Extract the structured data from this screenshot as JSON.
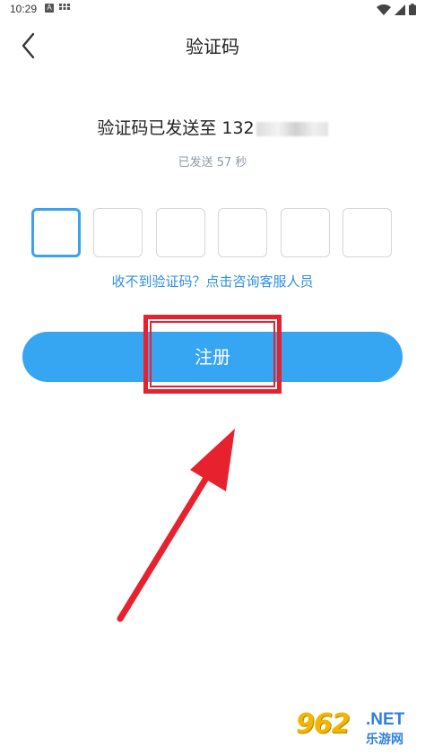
{
  "status_bar": {
    "time": "10:29",
    "notification_a": "A"
  },
  "header": {
    "title": "验证码"
  },
  "verification": {
    "sent_prefix": "验证码已发送至 132",
    "countdown": "已发送 57 秒",
    "code_boxes": [
      "",
      "",
      "",
      "",
      "",
      ""
    ],
    "active_index": 0
  },
  "help": {
    "link_text": "收不到验证码？点击咨询客服人员"
  },
  "actions": {
    "register_label": "注册"
  },
  "annotation": {
    "highlight_color": "#e8212e"
  },
  "watermark": {
    "logo": "962",
    "domain": ".NET",
    "name": "乐游网"
  },
  "colors": {
    "accent": "#36a5f2",
    "link": "#2f8fe0",
    "countdown": "#8e99a5",
    "active_border": "#3aa2ee"
  }
}
